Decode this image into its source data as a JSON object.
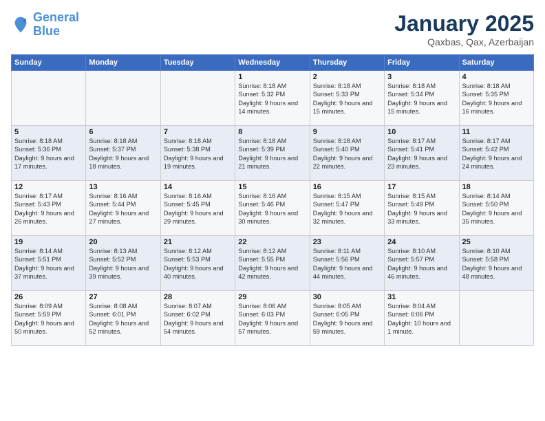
{
  "header": {
    "logo_line1": "General",
    "logo_line2": "Blue",
    "title": "January 2025",
    "subtitle": "Qaxbas, Qax, Azerbaijan"
  },
  "weekdays": [
    "Sunday",
    "Monday",
    "Tuesday",
    "Wednesday",
    "Thursday",
    "Friday",
    "Saturday"
  ],
  "weeks": [
    [
      {
        "day": "",
        "info": ""
      },
      {
        "day": "",
        "info": ""
      },
      {
        "day": "",
        "info": ""
      },
      {
        "day": "1",
        "info": "Sunrise: 8:18 AM\nSunset: 5:32 PM\nDaylight: 9 hours\nand 14 minutes."
      },
      {
        "day": "2",
        "info": "Sunrise: 8:18 AM\nSunset: 5:33 PM\nDaylight: 9 hours\nand 15 minutes."
      },
      {
        "day": "3",
        "info": "Sunrise: 8:18 AM\nSunset: 5:34 PM\nDaylight: 9 hours\nand 15 minutes."
      },
      {
        "day": "4",
        "info": "Sunrise: 8:18 AM\nSunset: 5:35 PM\nDaylight: 9 hours\nand 16 minutes."
      }
    ],
    [
      {
        "day": "5",
        "info": "Sunrise: 8:18 AM\nSunset: 5:36 PM\nDaylight: 9 hours\nand 17 minutes."
      },
      {
        "day": "6",
        "info": "Sunrise: 8:18 AM\nSunset: 5:37 PM\nDaylight: 9 hours\nand 18 minutes."
      },
      {
        "day": "7",
        "info": "Sunrise: 8:18 AM\nSunset: 5:38 PM\nDaylight: 9 hours\nand 19 minutes."
      },
      {
        "day": "8",
        "info": "Sunrise: 8:18 AM\nSunset: 5:39 PM\nDaylight: 9 hours\nand 21 minutes."
      },
      {
        "day": "9",
        "info": "Sunrise: 8:18 AM\nSunset: 5:40 PM\nDaylight: 9 hours\nand 22 minutes."
      },
      {
        "day": "10",
        "info": "Sunrise: 8:17 AM\nSunset: 5:41 PM\nDaylight: 9 hours\nand 23 minutes."
      },
      {
        "day": "11",
        "info": "Sunrise: 8:17 AM\nSunset: 5:42 PM\nDaylight: 9 hours\nand 24 minutes."
      }
    ],
    [
      {
        "day": "12",
        "info": "Sunrise: 8:17 AM\nSunset: 5:43 PM\nDaylight: 9 hours\nand 26 minutes."
      },
      {
        "day": "13",
        "info": "Sunrise: 8:16 AM\nSunset: 5:44 PM\nDaylight: 9 hours\nand 27 minutes."
      },
      {
        "day": "14",
        "info": "Sunrise: 8:16 AM\nSunset: 5:45 PM\nDaylight: 9 hours\nand 29 minutes."
      },
      {
        "day": "15",
        "info": "Sunrise: 8:16 AM\nSunset: 5:46 PM\nDaylight: 9 hours\nand 30 minutes."
      },
      {
        "day": "16",
        "info": "Sunrise: 8:15 AM\nSunset: 5:47 PM\nDaylight: 9 hours\nand 32 minutes."
      },
      {
        "day": "17",
        "info": "Sunrise: 8:15 AM\nSunset: 5:49 PM\nDaylight: 9 hours\nand 33 minutes."
      },
      {
        "day": "18",
        "info": "Sunrise: 8:14 AM\nSunset: 5:50 PM\nDaylight: 9 hours\nand 35 minutes."
      }
    ],
    [
      {
        "day": "19",
        "info": "Sunrise: 8:14 AM\nSunset: 5:51 PM\nDaylight: 9 hours\nand 37 minutes."
      },
      {
        "day": "20",
        "info": "Sunrise: 8:13 AM\nSunset: 5:52 PM\nDaylight: 9 hours\nand 39 minutes."
      },
      {
        "day": "21",
        "info": "Sunrise: 8:12 AM\nSunset: 5:53 PM\nDaylight: 9 hours\nand 40 minutes."
      },
      {
        "day": "22",
        "info": "Sunrise: 8:12 AM\nSunset: 5:55 PM\nDaylight: 9 hours\nand 42 minutes."
      },
      {
        "day": "23",
        "info": "Sunrise: 8:11 AM\nSunset: 5:56 PM\nDaylight: 9 hours\nand 44 minutes."
      },
      {
        "day": "24",
        "info": "Sunrise: 8:10 AM\nSunset: 5:57 PM\nDaylight: 9 hours\nand 46 minutes."
      },
      {
        "day": "25",
        "info": "Sunrise: 8:10 AM\nSunset: 5:58 PM\nDaylight: 9 hours\nand 48 minutes."
      }
    ],
    [
      {
        "day": "26",
        "info": "Sunrise: 8:09 AM\nSunset: 5:59 PM\nDaylight: 9 hours\nand 50 minutes."
      },
      {
        "day": "27",
        "info": "Sunrise: 8:08 AM\nSunset: 6:01 PM\nDaylight: 9 hours\nand 52 minutes."
      },
      {
        "day": "28",
        "info": "Sunrise: 8:07 AM\nSunset: 6:02 PM\nDaylight: 9 hours\nand 54 minutes."
      },
      {
        "day": "29",
        "info": "Sunrise: 8:06 AM\nSunset: 6:03 PM\nDaylight: 9 hours\nand 57 minutes."
      },
      {
        "day": "30",
        "info": "Sunrise: 8:05 AM\nSunset: 6:05 PM\nDaylight: 9 hours\nand 59 minutes."
      },
      {
        "day": "31",
        "info": "Sunrise: 8:04 AM\nSunset: 6:06 PM\nDaylight: 10 hours\nand 1 minute."
      },
      {
        "day": "",
        "info": ""
      }
    ]
  ]
}
